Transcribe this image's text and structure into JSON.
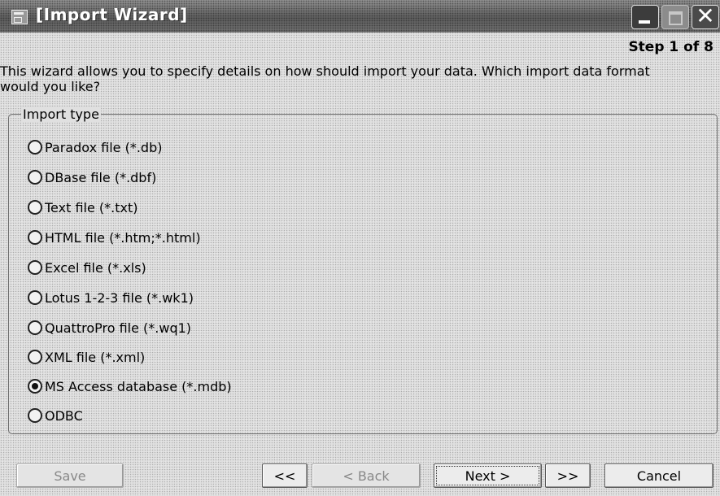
{
  "window": {
    "title": "[Import Wizard]",
    "icon": "app-icon",
    "controls": [
      "minimize-icon",
      "maximize-icon",
      "close-icon"
    ],
    "close_glyph": "✕"
  },
  "step": "Step 1 of 8",
  "intro": "This wizard allows you to specify details on how should import your data. Which import data format would you like?",
  "import_type": {
    "legend": "Import type",
    "selected": "MS Access database (*.mdb)",
    "options": [
      {
        "label": "Paradox file (*.db)",
        "checked": false
      },
      {
        "label": "DBase file (*.dbf)",
        "checked": false
      },
      {
        "label": "Text file (*.txt)",
        "checked": false
      },
      {
        "label": "HTML file (*.htm;*.html)",
        "checked": false
      },
      {
        "label": "Excel file (*.xls)",
        "checked": false
      },
      {
        "label": "Lotus 1-2-3 file (*.wk1)",
        "checked": false
      },
      {
        "label": "QuattroPro file (*.wq1)",
        "checked": false
      },
      {
        "label": "XML file (*.xml)",
        "checked": false
      },
      {
        "label": "MS Access database (*.mdb)",
        "checked": true
      },
      {
        "label": "ODBC",
        "checked": false
      }
    ]
  },
  "buttons": {
    "save": "Save",
    "first": "<<",
    "back": "< Back",
    "next": "Next >",
    "last": ">>",
    "cancel": "Cancel"
  }
}
